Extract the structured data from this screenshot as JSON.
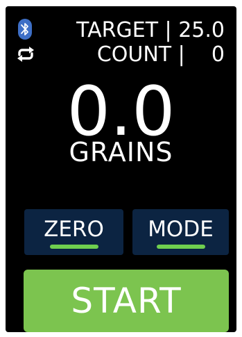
{
  "status": {
    "target_text": "TARGET | 25.0",
    "count_text": "COUNT |    0"
  },
  "display": {
    "weight": "0.0",
    "unit": "GRAINS"
  },
  "buttons": {
    "zero_label": "ZERO",
    "mode_label": "MODE",
    "start_label": "START"
  },
  "icons": {
    "bluetooth": "bluetooth-icon",
    "loop": "loop-icon"
  },
  "colors": {
    "background": "#000000",
    "button_dark": "#0c2442",
    "accent_green": "#7cc44f",
    "indicator_green": "#6fcf4f",
    "bluetooth_blue": "#3e6fc6",
    "text": "#ffffff"
  }
}
